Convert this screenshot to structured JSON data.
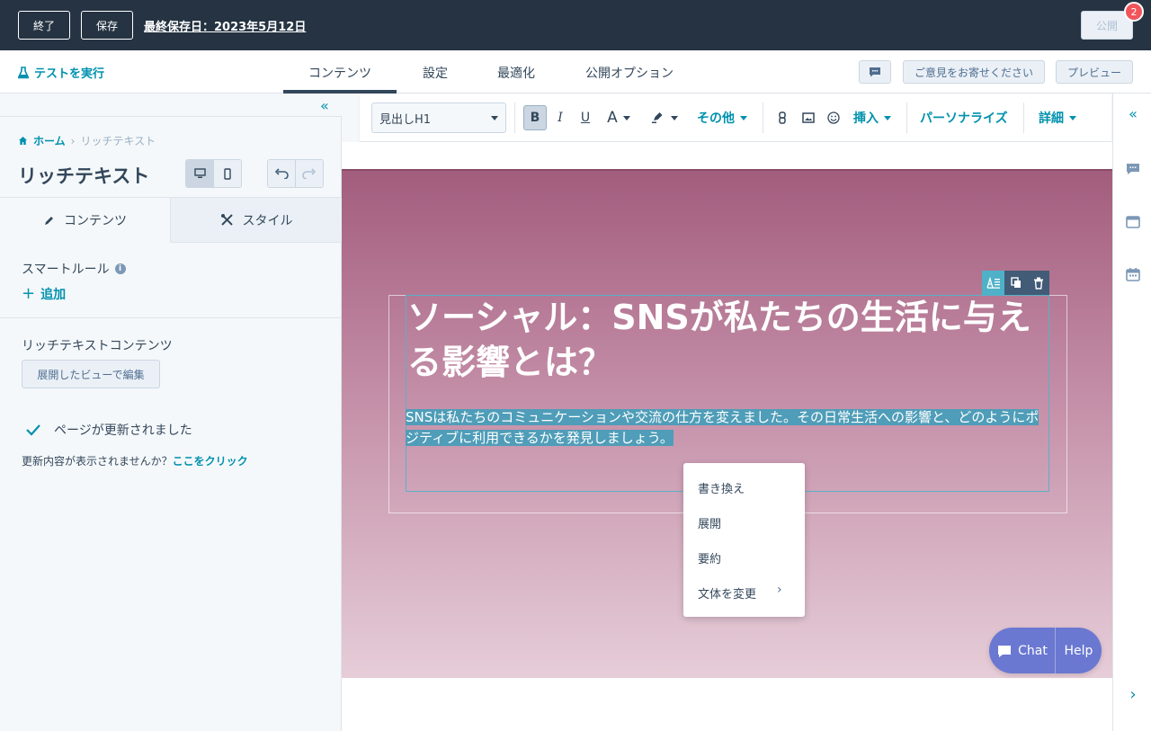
{
  "topbar": {
    "exit_label": "終了",
    "save_label": "保存",
    "last_saved": "最終保存日：2023年5月12日",
    "publish_label": "公開",
    "publish_badge": "2"
  },
  "navbar": {
    "test_label": "テストを実行",
    "tabs": [
      {
        "label": "コンテンツ",
        "active": true
      },
      {
        "label": "設定",
        "active": false
      },
      {
        "label": "最適化",
        "active": false
      },
      {
        "label": "公開オプション",
        "active": false
      }
    ],
    "feedback_label": "ご意見をお寄せください",
    "preview_label": "プレビュー"
  },
  "sidebar": {
    "breadcrumb_home": "ホーム",
    "breadcrumb_current": "リッチテキスト",
    "title": "リッチテキスト",
    "tabs": [
      {
        "label": "コンテンツ",
        "active": true
      },
      {
        "label": "スタイル",
        "active": false
      }
    ],
    "smart_rules_label": "スマートルール",
    "add_label": "追加",
    "rich_text_label": "リッチテキストコンテンツ",
    "edit_expanded_label": "展開したビューで編集",
    "updated_message": "ページが更新されました",
    "not_showing_text": "更新内容が表示されませんか？",
    "click_here": "ここをクリック"
  },
  "toolbar": {
    "style_select": "見出しH1",
    "more_label": "その他",
    "insert_label": "挿入",
    "personalize_label": "パーソナライズ",
    "details_label": "詳細"
  },
  "canvas": {
    "title": "ソーシャル：SNSが私たちの生活に与える影響とは？",
    "body": "SNSは私たちのコミュニケーションや交流の仕方を変えました。その日常生活への影響と、どのようにポジティブに利用できるかを発見しましょう。"
  },
  "context_menu": {
    "items": [
      "書き換え",
      "展開",
      "要約",
      "文体を変更"
    ]
  },
  "chat_widget": {
    "chat_label": "Chat",
    "help_label": "Help"
  },
  "colors": {
    "accent": "#0091ae",
    "topbar": "#253342",
    "selection": "#4f9db8",
    "chat": "#6a78d1"
  }
}
